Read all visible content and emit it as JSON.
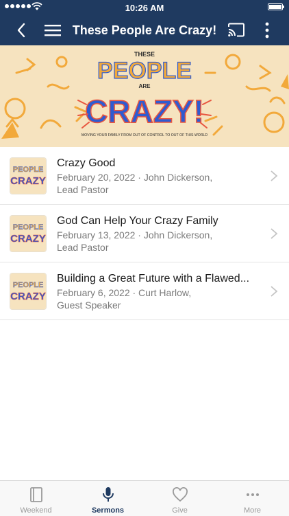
{
  "status_bar": {
    "time": "10:26 AM"
  },
  "nav": {
    "title": "These People Are Crazy!"
  },
  "banner": {
    "line1": "THESE",
    "line2": "PEOPLE",
    "line3": "ARE",
    "line4": "CRAZY!",
    "tagline": "MOVING YOUR FAMILY FROM OUT OF CONTROL TO OUT OF THIS WORLD"
  },
  "sermons": [
    {
      "title": "Crazy Good",
      "meta_line1": "February 20, 2022 · John Dickerson,",
      "meta_line2": "Lead Pastor"
    },
    {
      "title": "God Can Help Your Crazy Family",
      "meta_line1": "February 13, 2022 · John Dickerson,",
      "meta_line2": "Lead Pastor"
    },
    {
      "title": "Building a Great Future with a Flawed...",
      "meta_line1": "February 6, 2022 · Curt Harlow,",
      "meta_line2": "Guest Speaker"
    }
  ],
  "thumb": {
    "line1": "PEOPLE",
    "line2": "CRAZY"
  },
  "tabs": [
    {
      "label": "Weekend",
      "icon": "book-icon"
    },
    {
      "label": "Sermons",
      "icon": "microphone-icon"
    },
    {
      "label": "Give",
      "icon": "heart-icon"
    },
    {
      "label": "More",
      "icon": "ellipsis-icon"
    }
  ],
  "colors": {
    "nav": "#1f3a60",
    "banner_bg": "#f6e3bf",
    "accent_orange": "#f2a93b",
    "accent_blue": "#2f5bd0",
    "accent_red": "#e8553f"
  }
}
